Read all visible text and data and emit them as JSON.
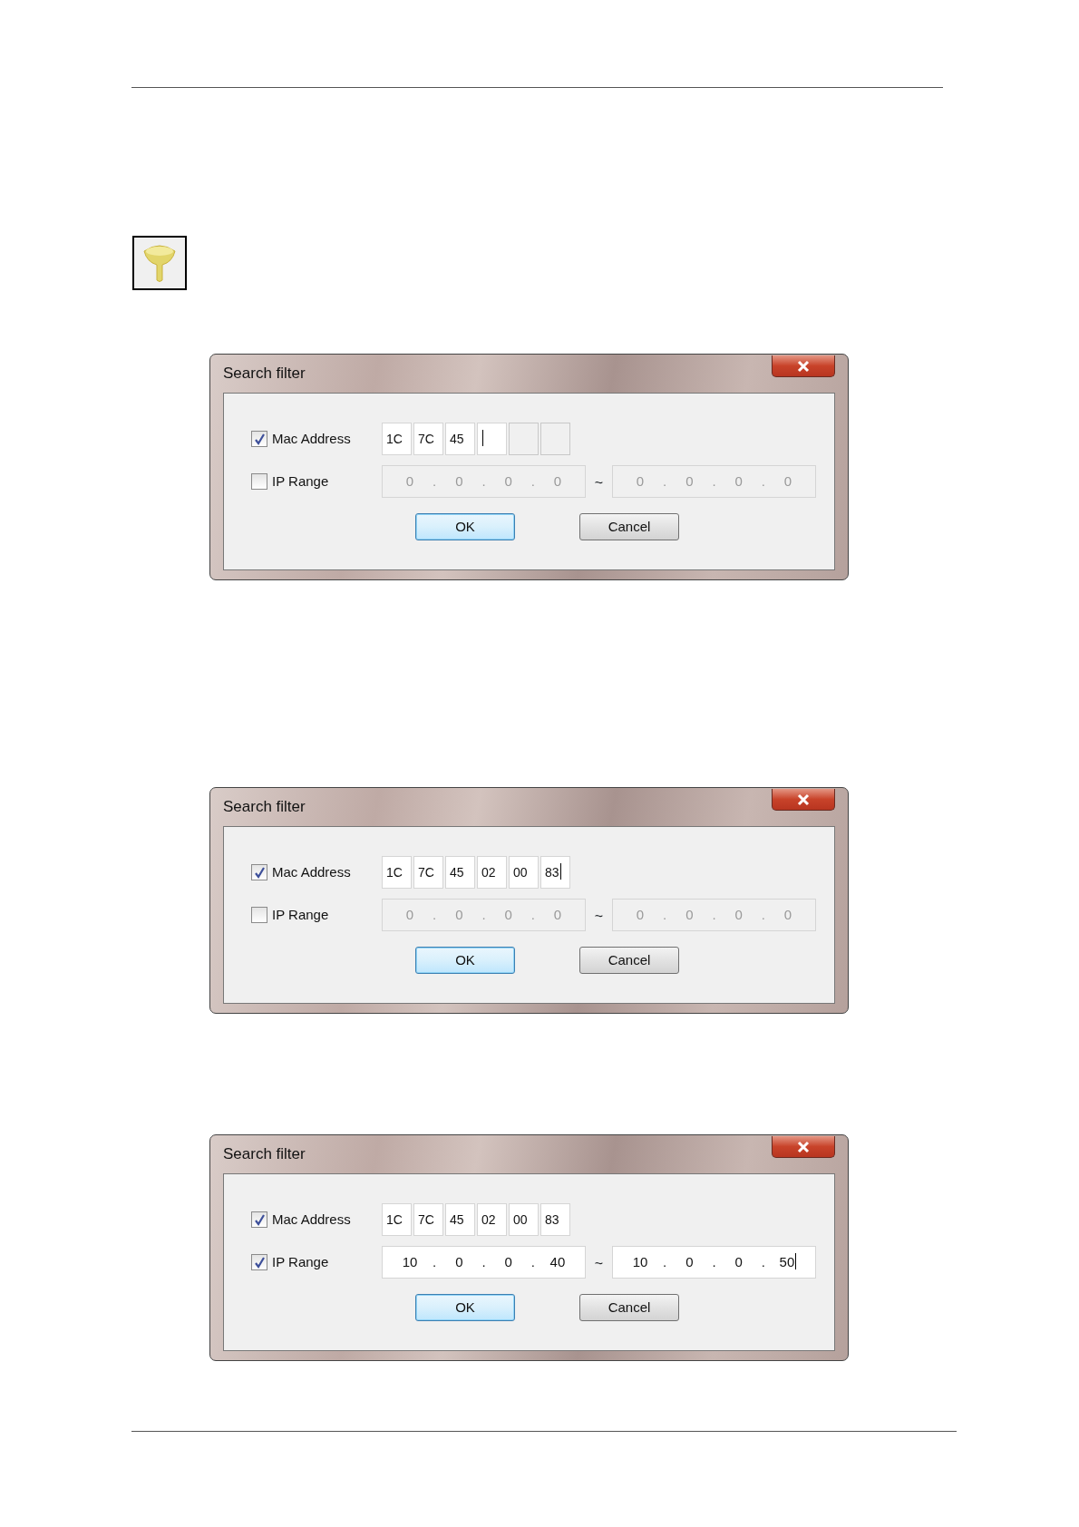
{
  "dialogs": [
    {
      "title": "Search filter",
      "mac_address": {
        "label": "Mac Address",
        "checked": true,
        "fields": [
          {
            "value": "1C",
            "enabled": true,
            "focused": false
          },
          {
            "value": "7C",
            "enabled": true,
            "focused": false
          },
          {
            "value": "45",
            "enabled": true,
            "focused": false
          },
          {
            "enabled": true,
            "focused": true
          },
          {
            "enabled": false,
            "focused": false
          },
          {
            "enabled": false,
            "focused": false
          }
        ]
      },
      "ip_range": {
        "label": "IP Range",
        "checked": false,
        "separator": "~",
        "start": {
          "octets": [
            "0",
            "0",
            "0",
            "0"
          ],
          "dot": ".",
          "focused": false
        },
        "end": {
          "octets": [
            "0",
            "0",
            "0",
            "0"
          ],
          "dot": ".",
          "focused": false
        }
      },
      "buttons": [
        {
          "label": "OK",
          "default": true
        },
        {
          "label": "Cancel",
          "default": false
        }
      ]
    },
    {
      "title": "Search filter",
      "mac_address": {
        "label": "Mac Address",
        "checked": true,
        "fields": [
          {
            "value": "1C",
            "enabled": true,
            "focused": false
          },
          {
            "value": "7C",
            "enabled": true,
            "focused": false
          },
          {
            "value": "45",
            "enabled": true,
            "focused": false
          },
          {
            "value": "02",
            "enabled": true,
            "focused": false
          },
          {
            "value": "00",
            "enabled": true,
            "focused": false
          },
          {
            "value": "83",
            "enabled": true,
            "focused": true
          }
        ]
      },
      "ip_range": {
        "label": "IP Range",
        "checked": false,
        "separator": "~",
        "start": {
          "octets": [
            "0",
            "0",
            "0",
            "0"
          ],
          "dot": ".",
          "focused": false
        },
        "end": {
          "octets": [
            "0",
            "0",
            "0",
            "0"
          ],
          "dot": ".",
          "focused": false
        }
      },
      "buttons": [
        {
          "label": "OK",
          "default": true
        },
        {
          "label": "Cancel",
          "default": false
        }
      ]
    },
    {
      "title": "Search filter",
      "mac_address": {
        "label": "Mac Address",
        "checked": true,
        "fields": [
          {
            "value": "1C",
            "enabled": true,
            "focused": false
          },
          {
            "value": "7C",
            "enabled": true,
            "focused": false
          },
          {
            "value": "45",
            "enabled": true,
            "focused": false
          },
          {
            "value": "02",
            "enabled": true,
            "focused": false
          },
          {
            "value": "00",
            "enabled": true,
            "focused": false
          },
          {
            "value": "83",
            "enabled": true,
            "focused": false
          }
        ]
      },
      "ip_range": {
        "label": "IP Range",
        "checked": true,
        "separator": "~",
        "start": {
          "octets": [
            "10",
            "0",
            "0",
            "40"
          ],
          "dot": ".",
          "focused": false
        },
        "end": {
          "octets": [
            "10",
            "0",
            "0",
            "50"
          ],
          "dot": ".",
          "focused": true
        }
      },
      "buttons": [
        {
          "label": "OK",
          "default": true
        },
        {
          "label": "Cancel",
          "default": false
        }
      ]
    }
  ]
}
